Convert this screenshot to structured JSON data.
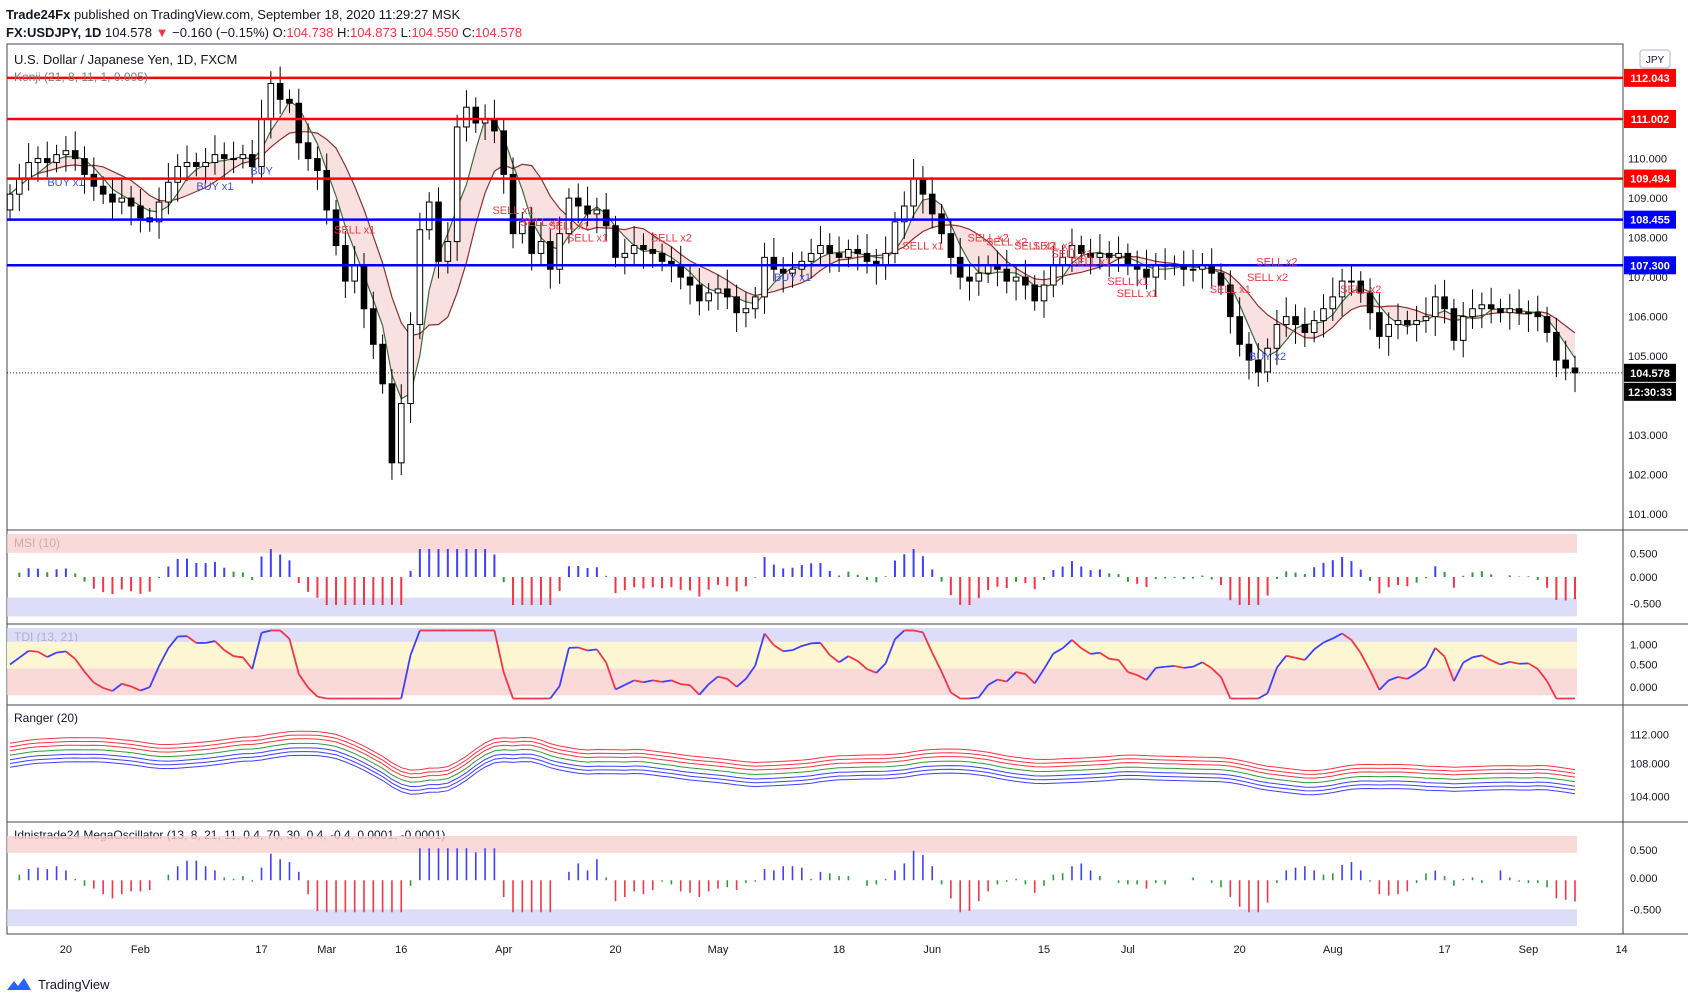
{
  "header": {
    "publisher": "Trade24Fx",
    "published_text": "published on TradingView.com, September 18, 2020 11:29:27 MSK",
    "symbol": "FX:USDJPY, 1D",
    "last": "104.578",
    "change": "−0.160 (−0.15%)",
    "o_label": "O:",
    "o": "104.738",
    "h_label": "H:",
    "h": "104.873",
    "l_label": "L:",
    "l": "104.550",
    "c_label": "C:",
    "c": "104.578"
  },
  "footer": {
    "brand": "TradingView"
  },
  "colors": {
    "up": "#ffffff",
    "down": "#000000",
    "red_line": "#ff0000",
    "blue_line": "#0000ff",
    "sell": "#f23645",
    "buy": "#3f51d8",
    "ranger_red": "#f23645",
    "ranger_blue": "#3f3fff",
    "ranger_green": "#2e9c3a"
  },
  "chart_data": {
    "type": "candlestick",
    "title": "U.S. Dollar / Japanese Yen, 1D, FXCM",
    "indicator": "Kenji (21, 8, 11, 1, 0.005)",
    "currency_label": "JPY",
    "y_ticks": [
      "112.000",
      "111.000",
      "110.000",
      "109.000",
      "108.000",
      "107.000",
      "106.000",
      "105.000",
      "104.000",
      "103.000",
      "102.000",
      "101.000"
    ],
    "ylim": [
      100.6,
      112.9
    ],
    "x_ticks": [
      "20",
      "Feb",
      "17",
      "Mar",
      "16",
      "Apr",
      "20",
      "May",
      "18",
      "Jun",
      "15",
      "Jul",
      "20",
      "Aug",
      "17",
      "Sep",
      "14"
    ],
    "x_tick_days": [
      6,
      14,
      27,
      34,
      42,
      53,
      65,
      76,
      89,
      99,
      111,
      120,
      132,
      142,
      154,
      163,
      173
    ],
    "levels": [
      {
        "value": 112.043,
        "label": "112.043",
        "color": "red"
      },
      {
        "value": 111.002,
        "label": "111.002",
        "color": "red"
      },
      {
        "value": 109.494,
        "label": "109.494",
        "color": "red"
      },
      {
        "value": 108.455,
        "label": "108.455",
        "color": "blue"
      },
      {
        "value": 107.3,
        "label": "107.300",
        "color": "blue"
      }
    ],
    "last_price": {
      "value": 104.578,
      "label": "104.578",
      "countdown": "12:30:33"
    },
    "closes": [
      109.1,
      109.5,
      109.9,
      110.0,
      109.9,
      110.1,
      110.2,
      110.0,
      109.6,
      109.3,
      109.1,
      108.9,
      109.0,
      108.8,
      108.5,
      108.4,
      108.9,
      109.4,
      109.8,
      109.9,
      109.8,
      109.9,
      110.1,
      110.0,
      110.0,
      110.1,
      109.8,
      111.0,
      111.9,
      111.5,
      111.4,
      110.4,
      110.0,
      109.7,
      108.7,
      107.8,
      106.9,
      107.3,
      106.2,
      105.3,
      104.3,
      102.3,
      103.8,
      105.8,
      108.2,
      108.9,
      107.4,
      107.9,
      110.8,
      111.3,
      110.9,
      111.0,
      110.7,
      109.6,
      108.1,
      108.4,
      107.6,
      107.9,
      107.2,
      108.1,
      109.0,
      108.8,
      108.6,
      108.7,
      108.3,
      107.5,
      107.6,
      107.8,
      107.7,
      107.6,
      107.4,
      107.3,
      107.0,
      106.8,
      106.4,
      106.6,
      106.7,
      106.5,
      106.1,
      106.2,
      106.5,
      107.5,
      107.2,
      107.1,
      107.2,
      107.4,
      107.6,
      107.8,
      107.6,
      107.5,
      107.7,
      107.6,
      107.4,
      107.3,
      107.6,
      108.4,
      108.8,
      109.5,
      109.1,
      108.6,
      108.1,
      107.5,
      107.0,
      106.9,
      107.1,
      107.3,
      107.2,
      106.9,
      107.0,
      106.8,
      106.4,
      106.8,
      107.3,
      107.5,
      107.8,
      107.6,
      107.5,
      107.6,
      107.5,
      107.6,
      107.3,
      107.2,
      107.0,
      107.3,
      107.3,
      107.3,
      107.2,
      107.2,
      107.3,
      107.1,
      106.8,
      106.0,
      105.3,
      104.9,
      104.6,
      105.2,
      105.8,
      106.0,
      105.8,
      105.6,
      105.9,
      106.2,
      106.5,
      106.9,
      106.9,
      106.6,
      106.1,
      105.5,
      105.8,
      105.9,
      105.8,
      105.9,
      106.0,
      106.5,
      106.2,
      105.4,
      106.0,
      106.2,
      106.3,
      106.2,
      106.1,
      106.2,
      106.1,
      106.1,
      106.0,
      105.6,
      104.9,
      104.7,
      104.578
    ],
    "signals": [
      {
        "text": "BUY x1",
        "day": 6,
        "price": 109.3,
        "side": "buy"
      },
      {
        "text": "BUY x1",
        "day": 22,
        "price": 109.2,
        "side": "buy"
      },
      {
        "text": "BUY",
        "day": 27,
        "price": 109.6,
        "side": "buy"
      },
      {
        "text": "SELL x1",
        "day": 37,
        "price": 108.1,
        "side": "sell"
      },
      {
        "text": "SELL x1",
        "day": 54,
        "price": 108.6,
        "side": "sell"
      },
      {
        "text": "SELL x1",
        "day": 57,
        "price": 108.3,
        "side": "sell"
      },
      {
        "text": "SELL x1",
        "day": 60,
        "price": 108.2,
        "side": "sell"
      },
      {
        "text": "SELL x1",
        "day": 62,
        "price": 107.9,
        "side": "sell"
      },
      {
        "text": "SELL x2",
        "day": 71,
        "price": 107.9,
        "side": "sell"
      },
      {
        "text": "BUY x1",
        "day": 84,
        "price": 106.9,
        "side": "buy"
      },
      {
        "text": "SELL x1",
        "day": 98,
        "price": 107.7,
        "side": "sell"
      },
      {
        "text": "SELL x2",
        "day": 105,
        "price": 107.9,
        "side": "sell"
      },
      {
        "text": "SELL x2",
        "day": 107,
        "price": 107.8,
        "side": "sell"
      },
      {
        "text": "SELL x2",
        "day": 110,
        "price": 107.7,
        "side": "sell"
      },
      {
        "text": "SELL x2",
        "day": 112,
        "price": 107.7,
        "side": "sell"
      },
      {
        "text": "SELL x1",
        "day": 114,
        "price": 107.5,
        "side": "sell"
      },
      {
        "text": "SELL x1",
        "day": 116,
        "price": 107.3,
        "side": "sell"
      },
      {
        "text": "SELL x1",
        "day": 120,
        "price": 106.8,
        "side": "sell"
      },
      {
        "text": "SELL x1",
        "day": 121,
        "price": 106.5,
        "side": "sell"
      },
      {
        "text": "SELL x1",
        "day": 131,
        "price": 106.6,
        "side": "sell"
      },
      {
        "text": "SELL x2",
        "day": 135,
        "price": 106.9,
        "side": "sell"
      },
      {
        "text": "SELL x2",
        "day": 136,
        "price": 107.3,
        "side": "sell"
      },
      {
        "text": "BUY x2",
        "day": 135,
        "price": 104.9,
        "side": "buy"
      },
      {
        "text": "SELL x2",
        "day": 145,
        "price": 106.6,
        "side": "sell"
      }
    ],
    "panes": [
      {
        "name": "MSI (10)",
        "ticks": [
          "0.500",
          "0.000",
          "-0.500"
        ]
      },
      {
        "name": "TDI (13, 21)",
        "ticks": [
          "1.000",
          "0.500",
          "0.000"
        ]
      },
      {
        "name": "Ranger (20)",
        "ticks": [
          "112.000",
          "108.000",
          "104.000"
        ]
      },
      {
        "name": "Idnistrade24 MegaOscillator (13, 8, 21, 11, 0.4, 70, 30, 0.4, -0.4, 0.0001, -0.0001)",
        "ticks": [
          "0.500",
          "0.000",
          "-0.500"
        ]
      }
    ]
  }
}
